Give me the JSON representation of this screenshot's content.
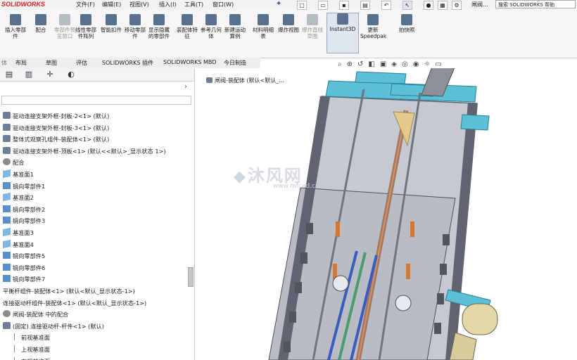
{
  "app": {
    "logo": "SOLIDWORKS",
    "document_title": "闸阀...",
    "help_search_placeholder": "搜索 SOLIDWORKS 帮助"
  },
  "menu": [
    "文件(F)",
    "编辑(E)",
    "视图(V)",
    "插入(I)",
    "工具(T)",
    "窗口(W)"
  ],
  "ribbon": [
    {
      "label": "插入零部件",
      "state": "normal"
    },
    {
      "label": "配合",
      "state": "normal"
    },
    {
      "label": "零部件预览窗口",
      "state": "disabled"
    },
    {
      "label": "线性零部件阵列",
      "state": "normal"
    },
    {
      "label": "智能扣件",
      "state": "normal"
    },
    {
      "label": "移动零部件",
      "state": "normal"
    },
    {
      "label": "显示隐藏的零部件",
      "state": "normal"
    },
    {
      "label": "装配体特征",
      "state": "normal"
    },
    {
      "label": "参考几何体",
      "state": "normal"
    },
    {
      "label": "新建运动算例",
      "state": "normal"
    },
    {
      "label": "材料明细表",
      "state": "normal"
    },
    {
      "label": "爆炸视图",
      "state": "normal"
    },
    {
      "label": "爆炸直线草图",
      "state": "disabled"
    },
    {
      "label": "Instant3D",
      "state": "selected"
    },
    {
      "label": "更新Speedpak",
      "state": "normal"
    },
    {
      "label": "拍快照",
      "state": "normal"
    }
  ],
  "tabs": [
    "布局",
    "草图",
    "评估",
    "SOLIDWORKS 插件",
    "SOLIDWORKS MBD",
    "今日制造"
  ],
  "panel_tabs": [
    {
      "icon": "feature-manager-icon",
      "glyph": "▤"
    },
    {
      "icon": "property-manager-icon",
      "glyph": "▥"
    },
    {
      "icon": "configuration-manager-icon",
      "glyph": "✛"
    },
    {
      "icon": "display-manager-icon",
      "glyph": "◐"
    }
  ],
  "tree": [
    {
      "label": "驱动连接支架外框-封板-2<1> (默认)",
      "icon": "asm",
      "indent": 0
    },
    {
      "label": "驱动连接支架外框-封板-3<1> (默认)",
      "icon": "asm",
      "indent": 0
    },
    {
      "label": "整体式观察孔组件-装配体<1> (默认)",
      "icon": "asm",
      "indent": 0
    },
    {
      "label": "驱动连接支架外框-顶板<1> (默认<<默认>_显示状态 1>)",
      "icon": "asm",
      "indent": 0
    },
    {
      "label": "配合",
      "icon": "mate",
      "indent": 0
    },
    {
      "label": "基准面1",
      "icon": "plane",
      "indent": 0
    },
    {
      "label": "镜向零部件1",
      "icon": "mirror",
      "indent": 0
    },
    {
      "label": "基准面2",
      "icon": "plane",
      "indent": 0
    },
    {
      "label": "镜向零部件2",
      "icon": "mirror",
      "indent": 0
    },
    {
      "label": "镜向零部件3",
      "icon": "mirror",
      "indent": 0
    },
    {
      "label": "基准面3",
      "icon": "plane",
      "indent": 0
    },
    {
      "label": "基准面4",
      "icon": "plane",
      "indent": 0
    },
    {
      "label": "镜向零部件5",
      "icon": "mirror",
      "indent": 0
    },
    {
      "label": "镜向零部件6",
      "icon": "mirror",
      "indent": 0
    },
    {
      "label": "镜向零部件7",
      "icon": "mirror",
      "indent": 0
    },
    {
      "label": "平衡杆组件-装配体<1> (默认<默认_显示状态-1>)",
      "icon": "none",
      "indent": 0
    },
    {
      "label": "连接驱动杆组件-装配体<1> (默认<默认_显示状态-1>)",
      "icon": "none",
      "indent": 0
    },
    {
      "label": "闸阀-装配体 中的配合",
      "icon": "mate",
      "indent": 0
    },
    {
      "label": "(固定) 连接驱动杆-杆件<1> (默认)",
      "icon": "asm",
      "indent": 0
    },
    {
      "label": "前视基准面",
      "icon": "line",
      "indent": 1
    },
    {
      "label": "上视基准面",
      "icon": "line",
      "indent": 1
    },
    {
      "label": "右视基准面",
      "icon": "line",
      "indent": 1
    }
  ],
  "graphics": {
    "breadcrumb": "闸阀-装配体  (默认<默认_...",
    "watermark": "沐风网",
    "watermark_url": "www.mfcad.com"
  },
  "colors": {
    "frame_blue": "#5bc0d6",
    "frame_grey": "#5f6470",
    "panel_grey": "#c6cad0",
    "rod_brown": "#a8765a",
    "rod_blue": "#3b5bbf",
    "rod_green": "#4a9a6a"
  }
}
